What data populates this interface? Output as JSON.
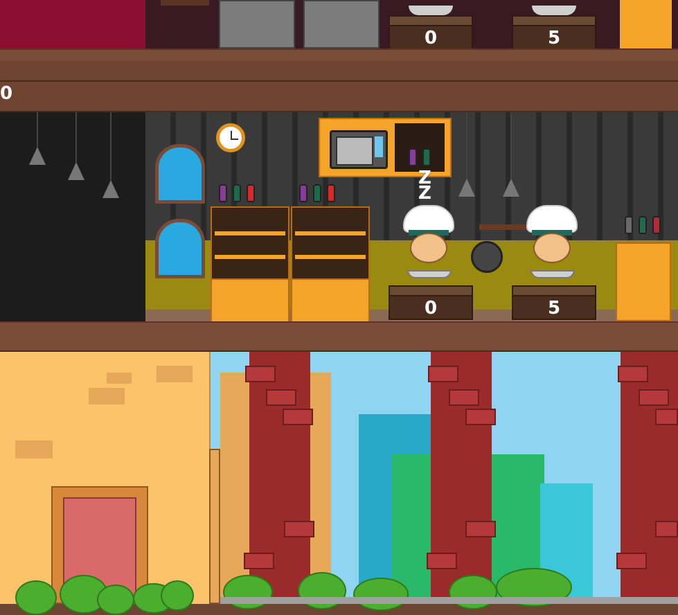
{
  "floor_top": {
    "counters": [
      {
        "value": "0"
      },
      {
        "value": "5"
      }
    ]
  },
  "floor_middle": {
    "side_label": "0",
    "counters": [
      {
        "value": "0"
      },
      {
        "value": "5"
      }
    ],
    "sleep_indicator": "Z Z",
    "chefs": [
      {
        "state": "sleeping"
      },
      {
        "state": "working"
      }
    ]
  },
  "colors": {
    "beam": "#7a4c37",
    "wall_dark": "#2a2a2a",
    "counter": "#4a2f20",
    "shelf": "#f5a32a",
    "sky": "#8fd4f0",
    "brick_pillar": "#9b2b2b",
    "building_wall": "#fcc46a"
  },
  "icons": [
    "clock-icon",
    "microwave-icon",
    "pan-icon",
    "lamp-icon",
    "window-icon",
    "bottle-icon",
    "sleep-z-icon"
  ]
}
